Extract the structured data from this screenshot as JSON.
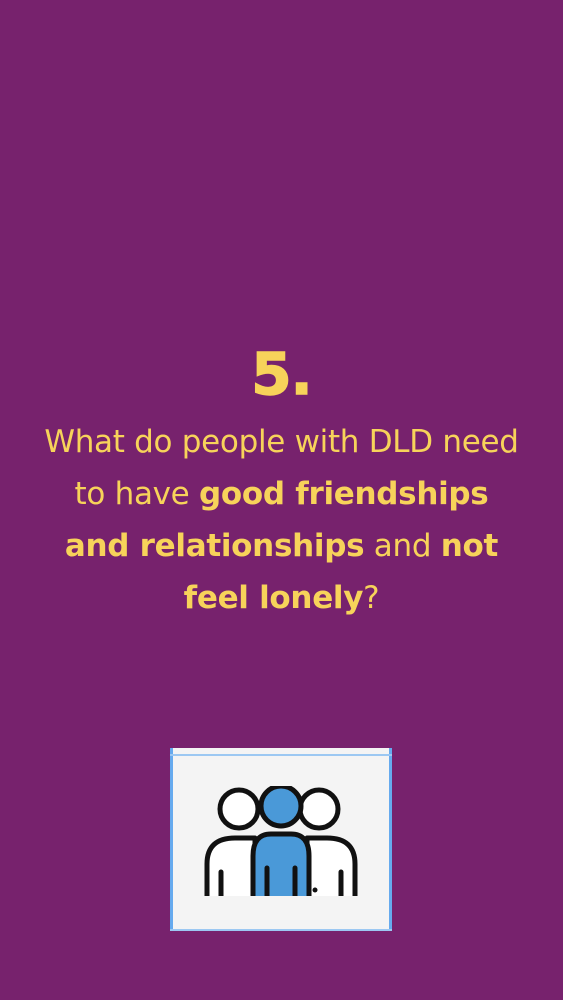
{
  "slide": {
    "number": "5.",
    "question": {
      "part1": "What do people with DLD need to have ",
      "bold1": "good friendships and relationships",
      "part2": " and ",
      "bold2": "not feel lonely",
      "part3": "?"
    },
    "icon": "group-of-people-icon"
  },
  "colors": {
    "background": "#77226d",
    "text": "#f7d35a",
    "icon_accent": "#4a99d8",
    "icon_card": "#f4f4f4"
  }
}
